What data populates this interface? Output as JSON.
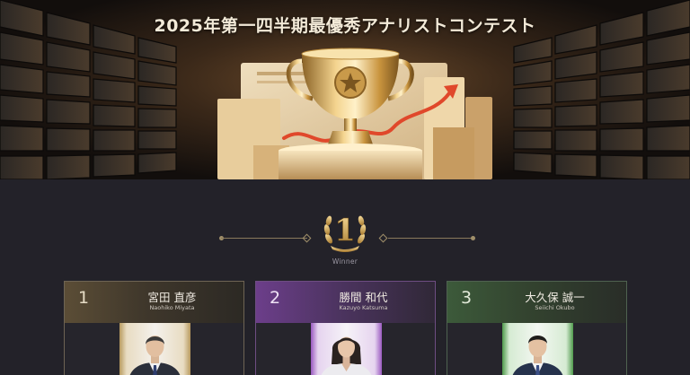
{
  "hero": {
    "title": "2025年第一四半期最優秀アナリストコンテスト"
  },
  "emblem": {
    "number": "1",
    "label": "Winner"
  },
  "cards": [
    {
      "rank": "1",
      "name_jp": "宮田 直彦",
      "name_en": "Naohiko Miyata",
      "accent": "#b89a5e"
    },
    {
      "rank": "2",
      "name_jp": "勝間 和代",
      "name_en": "Kazuyo Katsuma",
      "accent": "#9a59c0"
    },
    {
      "rank": "3",
      "name_jp": "大久保 誠一",
      "name_en": "Seiichi Okubo",
      "accent": "#4f9a4c"
    }
  ]
}
